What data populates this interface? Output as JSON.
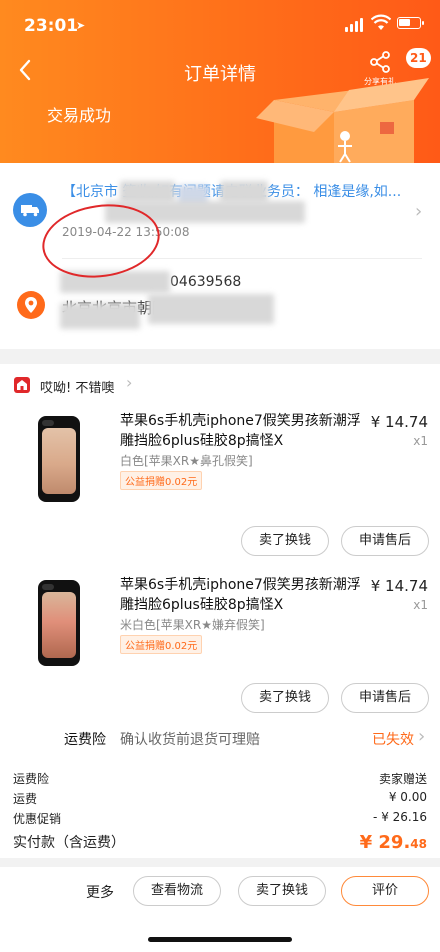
{
  "status_bar": {
    "time": "23:01",
    "battery_percent": 55
  },
  "nav": {
    "title": "订单详情",
    "share_label": "分享有礼",
    "badge_count": "21"
  },
  "order": {
    "status_text": "交易成功"
  },
  "logistics": {
    "text": "【北京市                       签收,如有问题请电联业务员：                    相逢是缘,如...",
    "time": "2019-04-22 13:50:08",
    "phone": "04639568",
    "address": "北京北京市朝阳区                       市朝阳区东"
  },
  "store": {
    "name": "哎呦! 不错噢"
  },
  "products": [
    {
      "title": "苹果6s手机壳iphone7假笑男孩新潮浮雕挡脸6plus硅胶8p搞怪X",
      "price": "¥ 14.74",
      "qty": "x1",
      "spec": "白色[苹果XR★鼻孔假笑]",
      "tag": "公益捐赠0.02元",
      "btn_left": "卖了换钱",
      "btn_right": "申请售后"
    },
    {
      "title": "苹果6s手机壳iphone7假笑男孩新潮浮雕挡脸6plus硅胶8p搞怪X",
      "price": "¥ 14.74",
      "qty": "x1",
      "spec": "米白色[苹果XR★嫌弃假笑]",
      "tag": "公益捐赠0.02元",
      "btn_left": "卖了换钱",
      "btn_right": "申请售后"
    }
  ],
  "freight_insurance": {
    "label": "运费险",
    "desc": "确认收货前退货可理赔",
    "status": "已失效"
  },
  "summary": {
    "rows": [
      {
        "label": "运费险",
        "value": "卖家赠送"
      },
      {
        "label": "运费",
        "value": "¥ 0.00"
      },
      {
        "label": "优惠促销",
        "value": "- ¥ 26.16"
      }
    ],
    "total_label": "实付款（含运费）",
    "total_main": "¥ 29.",
    "total_cents": "48"
  },
  "bottom_bar": {
    "more": "更多",
    "btn1": "查看物流",
    "btn2": "卖了换钱",
    "btn3": "评价"
  },
  "colors": {
    "accent": "#ff6a1a",
    "link_blue": "#3a8ee6",
    "annotation_red": "#e0282a"
  },
  "icons": [
    "back-icon",
    "share-icon",
    "truck-icon",
    "location-icon",
    "store-icon",
    "chevron-right-icon"
  ]
}
